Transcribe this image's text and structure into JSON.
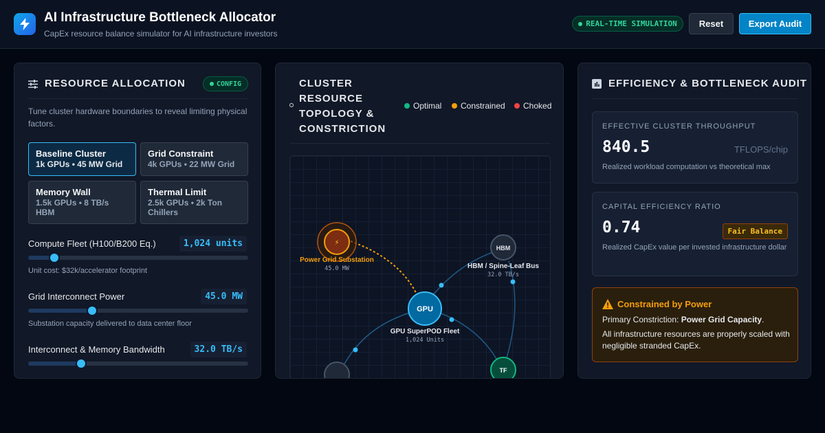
{
  "header": {
    "title": "AI Infrastructure Bottleneck Allocator",
    "subtitle": "CapEx resource balance simulator for AI infrastructure investors",
    "logo_icon": "lightning-bolt-icon",
    "sim_badge": "REAL-TIME SIMULATION",
    "reset_label": "Reset",
    "export_label": "Export Audit",
    "accent": "#0ea5e9"
  },
  "left": {
    "title": "RESOURCE ALLOCATION",
    "icon": "sliders-icon",
    "badge": "CONFIG",
    "description": "Tune cluster hardware boundaries to reveal limiting physical factors.",
    "presets": [
      {
        "name": "Baseline Cluster",
        "spec": "1k GPUs • 45 MW Grid",
        "active": true
      },
      {
        "name": "Grid Constraint",
        "spec": "4k GPUs • 22 MW Grid",
        "active": false
      },
      {
        "name": "Memory Wall",
        "spec": "1.5k GPUs • 8 TB/s HBM",
        "active": false
      },
      {
        "name": "Thermal Limit",
        "spec": "2.5k GPUs • 2k Ton Chillers",
        "active": false
      }
    ],
    "sliders": [
      {
        "label": "Compute Fleet (H100/B200 Eq.)",
        "value": "1,024 units",
        "fraction": 0.12,
        "note": "Unit cost: $32k/accelerator footprint"
      },
      {
        "label": "Grid Interconnect Power",
        "value": "45.0 MW",
        "fraction": 0.29,
        "note": "Substation capacity delivered to data center floor"
      },
      {
        "label": "Interconnect & Memory Bandwidth",
        "value": "32.0 TB/s",
        "fraction": 0.24,
        "note": ""
      }
    ]
  },
  "middle": {
    "title": "CLUSTER RESOURCE TOPOLOGY & CONSTRICTION",
    "legend": [
      {
        "label": "Optimal",
        "color": "#10b981"
      },
      {
        "label": "Constrained",
        "color": "#f59e0b"
      },
      {
        "label": "Choked",
        "color": "#ef4444"
      }
    ],
    "nodes": {
      "power": {
        "glyph": "⚡",
        "label": "Power Grid Substation",
        "value": "45.0 MW"
      },
      "hbm": {
        "glyph": "HBM",
        "label": "HBM / Spine-Leaf Bus",
        "value": "32.0 TB/s"
      },
      "gpu": {
        "glyph": "GPU",
        "label": "GPU SuperPOD Fleet",
        "value": "1,024 Units"
      },
      "tf": {
        "glyph": "TF"
      }
    }
  },
  "right": {
    "title": "EFFICIENCY & BOTTLENECK AUDIT",
    "icon": "bar-chart-icon",
    "throughput": {
      "label": "EFFECTIVE CLUSTER THROUGHPUT",
      "value": "840.5",
      "unit": "TFLOPS/chip",
      "note": "Realized workload computation vs theoretical max"
    },
    "capex": {
      "label": "CAPITAL EFFICIENCY RATIO",
      "value": "0.74",
      "badge": "Fair Balance",
      "note": "Realized CapEx value per invested infrastructure dollar"
    },
    "alert": {
      "icon": "warning-icon",
      "title": "Constrained by Power",
      "primary_prefix": "Primary Constriction: ",
      "primary_value": "Power Grid Capacity",
      "primary_suffix": ".",
      "message": "All infrastructure resources are properly scaled with negligible stranded CapEx."
    }
  }
}
